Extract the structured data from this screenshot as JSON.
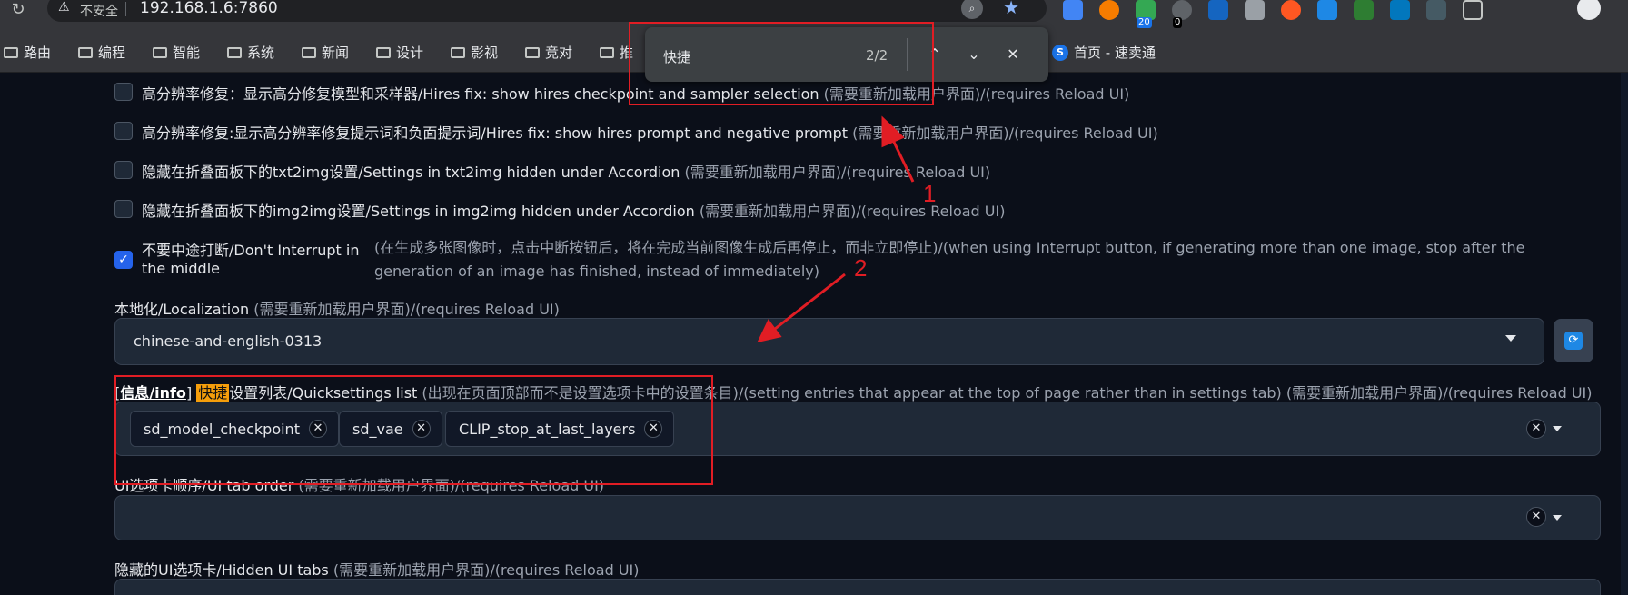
{
  "browser": {
    "insecure_label": "不安全",
    "url": "192.168.1.6:7860",
    "extension_badges": [
      "20",
      "0"
    ],
    "bookmarks": [
      "路由",
      "编程",
      "智能",
      "系统",
      "新闻",
      "设计",
      "影视",
      "竞对",
      "推",
      "首页 - 速卖通"
    ]
  },
  "findbar": {
    "query": "快捷",
    "count": "2/2"
  },
  "settings": {
    "rows": [
      {
        "label": "高分辨率修复：显示高分修复模型和采样器/Hires fix: show hires checkpoint and sampler selection",
        "note": " (需要重新加载用户界面)/(requires Reload UI)"
      },
      {
        "label": "高分辨率修复:显示高分辨率修复提示词和负面提示词/Hires fix: show hires prompt and negative prompt",
        "note": " (需要重新加载用户界面)/(requires Reload UI)"
      },
      {
        "label": "隐藏在折叠面板下的txt2img设置/Settings in txt2img hidden under Accordion",
        "note": " (需要重新加载用户界面)/(requires Reload UI)"
      },
      {
        "label": "隐藏在折叠面板下的img2img设置/Settings in img2img hidden under Accordion",
        "note": " (需要重新加载用户界面)/(requires Reload UI)"
      }
    ],
    "interrupt": {
      "label": "不要中途打断/Don't Interrupt in the middle",
      "description": "(在生成多张图像时，点击中断按钮后，将在完成当前图像生成后再停止，而非立即停止)/(when using Interrupt button, if generating more than one image, stop after the generation of an image has finished, instead of immediately)"
    },
    "localization": {
      "label": "本地化/Localization",
      "note": "(需要重新加载用户界面)/(requires Reload UI)",
      "value": "chinese-and-english-0313"
    },
    "quicksettings": {
      "info": "信息/info",
      "highlight": "快捷",
      "label": "设置列表/Quicksettings list",
      "note": " (出现在页面顶部而不是设置选项卡中的设置条目)/(setting entries that appear at the top of page rather than in settings tab) (需要重新加载用户界面)/(requires Reload UI)",
      "tags": [
        "sd_model_checkpoint",
        "sd_vae",
        "CLIP_stop_at_last_layers"
      ]
    },
    "tab_order": {
      "label": "UI选项卡顺序/UI tab order",
      "note": " (需要重新加载用户界面)/(requires Reload UI)"
    },
    "hidden_tabs": {
      "label": "隐藏的UI选项卡/Hidden UI tabs",
      "note": " (需要重新加载用户界面)/(requires Reload UI)"
    }
  },
  "annotations": [
    "1",
    "2"
  ]
}
